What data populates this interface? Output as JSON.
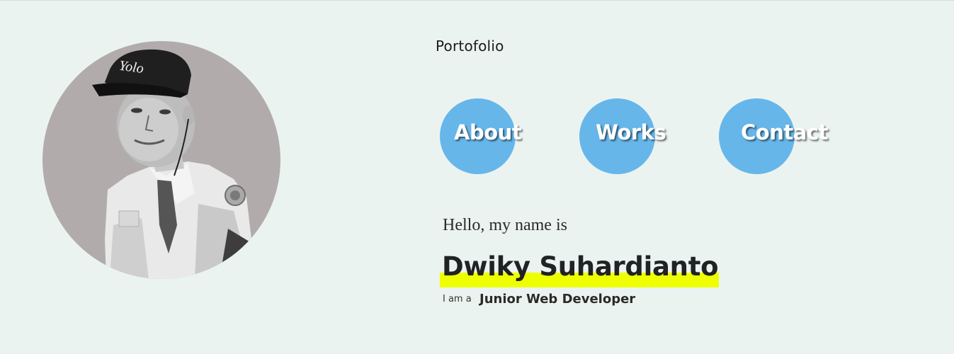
{
  "header": {
    "brand": "Portofolio"
  },
  "nav": {
    "items": [
      {
        "label": "About"
      },
      {
        "label": "Works"
      },
      {
        "label": "Contact"
      }
    ]
  },
  "profile": {
    "greeting": "Hello, my name is",
    "name": "Dwiky Suhardianto",
    "role_prefix": "I am a",
    "role": "Junior Web Developer",
    "cap_text": "Yolo"
  },
  "colors": {
    "background": "#ebf3f0",
    "nav_circle": "#66b6ea",
    "name_highlight": "#eeff00",
    "avatar_bg": "#b1acab"
  },
  "icons": {
    "avatar": "profile-photo"
  }
}
